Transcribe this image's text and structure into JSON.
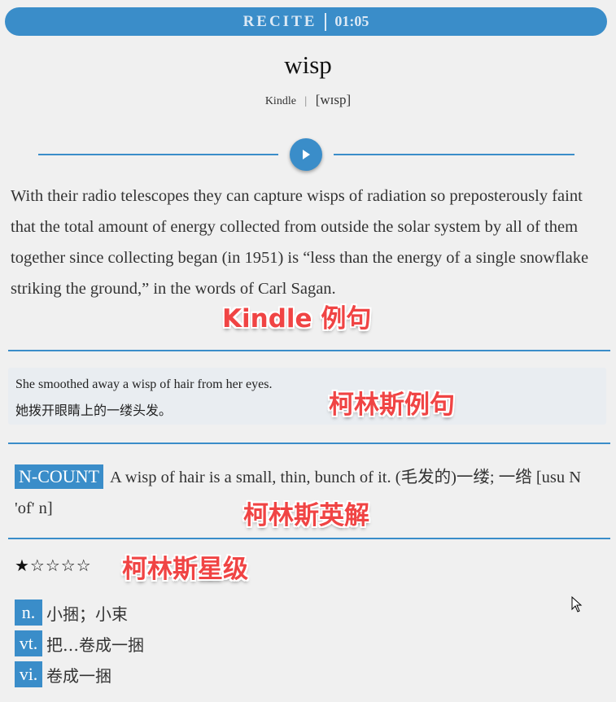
{
  "header": {
    "mode": "RECITE",
    "timer": "01:05"
  },
  "word": {
    "headword": "wisp",
    "source": "Kindle",
    "separator": "|",
    "phonetic": "[wɪsp]"
  },
  "kindle_example": "With their radio telescopes they can capture wisps of radiation so preposterously faint that the total amount of energy collected from outside the solar system by all of them together since collecting began (in 1951) is  “less than the energy of a single snowflake striking the ground,”  in the words of Carl Sagan.",
  "collins_example": {
    "en": "She smoothed away a wisp of hair from her eyes.",
    "zh": "她拨开眼睛上的一缕头发。"
  },
  "collins_definition": {
    "tag": "N-COUNT",
    "text": "A wisp of hair is a small, thin, bunch of it. (毛发的)一缕; 一绺 [usu N 'of' n]"
  },
  "collins_stars": "★☆☆☆☆",
  "definitions": [
    {
      "pos": "n.",
      "meaning": "小捆；小束"
    },
    {
      "pos": "vt.",
      "meaning": "把…卷成一捆"
    },
    {
      "pos": "vi.",
      "meaning": "卷成一捆"
    }
  ],
  "annotations": {
    "kindle": "Kindle 例句",
    "collins_example": "柯林斯例句",
    "collins_def": "柯林斯英解",
    "collins_star": "柯林斯星级"
  },
  "colors": {
    "accent": "#3a8dc9",
    "annotation": "#f04444",
    "background": "#f0f0f0"
  }
}
